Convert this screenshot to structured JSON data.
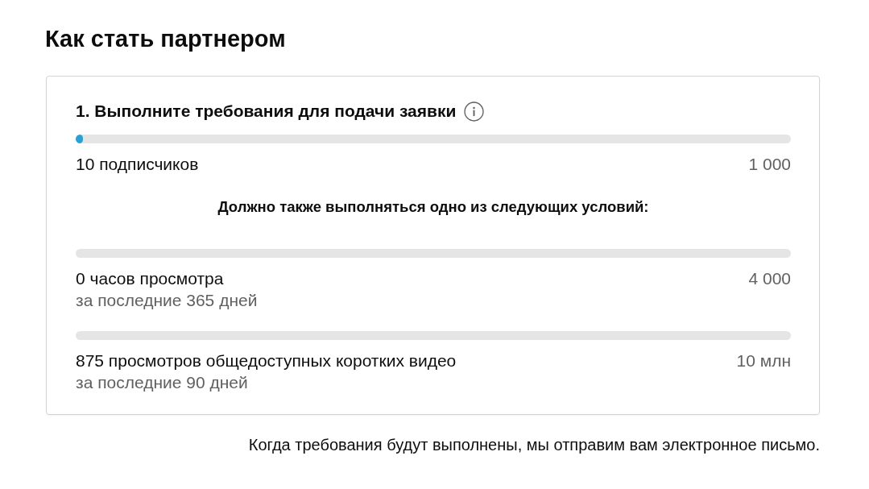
{
  "page": {
    "title": "Как стать партнером"
  },
  "card": {
    "step_title": "1. Выполните требования для подачи заявки",
    "requirements": [
      {
        "label": "10 подписчиков",
        "target": "1 000",
        "level": 0.01
      }
    ],
    "condition_note": "Должно также выполняться одно из следующих условий:",
    "alternatives": [
      {
        "label": "0 часов просмотра",
        "period": "за последние 365 дней",
        "target": "4 000"
      },
      {
        "label": "875 просмотров общедоступных коротких видео",
        "period": "за последние 90 дней",
        "target": "10 млн"
      }
    ]
  },
  "footer_note": "Когда требования будут выполнены, мы отправим вам электронное письмо."
}
